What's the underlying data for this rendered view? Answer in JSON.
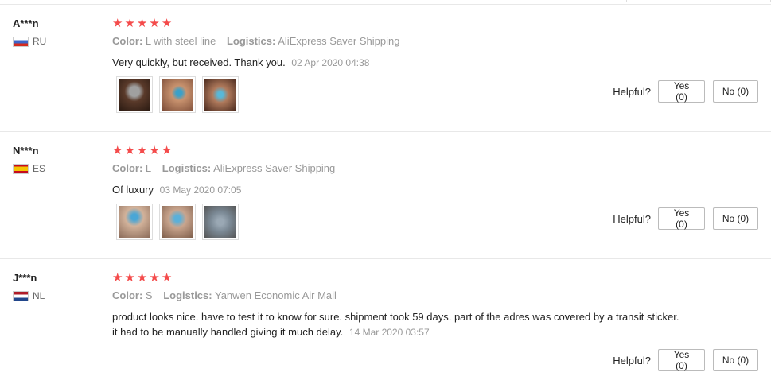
{
  "reviews": [
    {
      "user": "A***n",
      "country": "RU",
      "stars": [
        "★",
        "★",
        "★",
        "★",
        "★"
      ],
      "color_label": "Color:",
      "color_value": "L with steel line",
      "logistics_label": "Logistics:",
      "logistics_value": "AliExpress Saver Shipping",
      "text": "Very quickly, but received. Thank you.",
      "date": "02 Apr 2020 04:38",
      "helpful_label": "Helpful?",
      "yes_label": "Yes (0)",
      "no_label": "No (0)"
    },
    {
      "user": "N***n",
      "country": "ES",
      "stars": [
        "★",
        "★",
        "★",
        "★",
        "★"
      ],
      "color_label": "Color:",
      "color_value": "L",
      "logistics_label": "Logistics:",
      "logistics_value": "AliExpress Saver Shipping",
      "text": "Of luxury",
      "date": "03 May 2020 07:05",
      "helpful_label": "Helpful?",
      "yes_label": "Yes (0)",
      "no_label": "No (0)"
    },
    {
      "user": "J***n",
      "country": "NL",
      "stars": [
        "★",
        "★",
        "★",
        "★",
        "★"
      ],
      "color_label": "Color:",
      "color_value": "S",
      "logistics_label": "Logistics:",
      "logistics_value": "Yanwen Economic Air Mail",
      "text": "product looks nice. have to test it to know for sure. shipment took 59 days. part of the adres was covered by a transit sticker. it had to be manually handled giving it much delay.",
      "date": "14 Mar 2020 03:57",
      "helpful_label": "Helpful?",
      "yes_label": "Yes (0)",
      "no_label": "No (0)"
    }
  ],
  "colors": {
    "star": "#f44b4b",
    "muted": "#999999",
    "border": "#e8e8e8"
  }
}
